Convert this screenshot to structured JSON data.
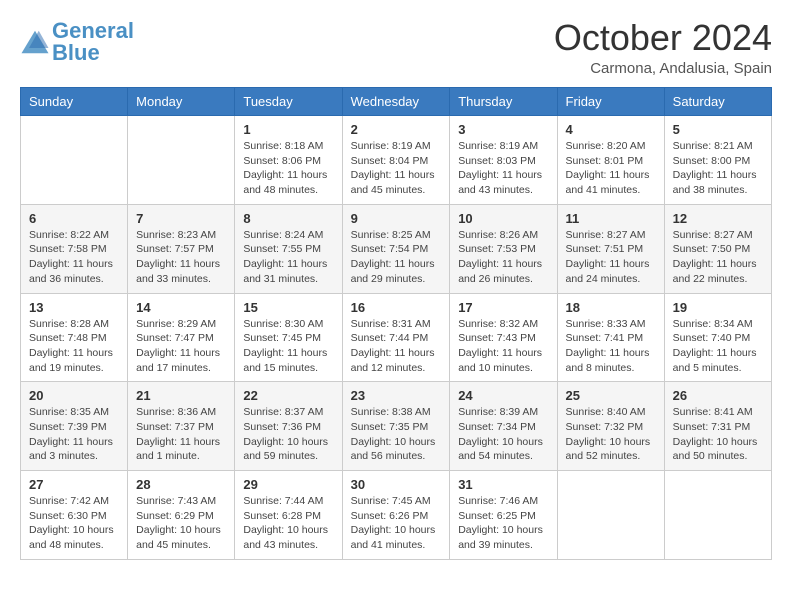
{
  "logo": {
    "line1": "General",
    "line2": "Blue"
  },
  "title": "October 2024",
  "subtitle": "Carmona, Andalusia, Spain",
  "days_of_week": [
    "Sunday",
    "Monday",
    "Tuesday",
    "Wednesday",
    "Thursday",
    "Friday",
    "Saturday"
  ],
  "weeks": [
    [
      {
        "day": "",
        "info": ""
      },
      {
        "day": "",
        "info": ""
      },
      {
        "day": "1",
        "info": "Sunrise: 8:18 AM\nSunset: 8:06 PM\nDaylight: 11 hours and 48 minutes."
      },
      {
        "day": "2",
        "info": "Sunrise: 8:19 AM\nSunset: 8:04 PM\nDaylight: 11 hours and 45 minutes."
      },
      {
        "day": "3",
        "info": "Sunrise: 8:19 AM\nSunset: 8:03 PM\nDaylight: 11 hours and 43 minutes."
      },
      {
        "day": "4",
        "info": "Sunrise: 8:20 AM\nSunset: 8:01 PM\nDaylight: 11 hours and 41 minutes."
      },
      {
        "day": "5",
        "info": "Sunrise: 8:21 AM\nSunset: 8:00 PM\nDaylight: 11 hours and 38 minutes."
      }
    ],
    [
      {
        "day": "6",
        "info": "Sunrise: 8:22 AM\nSunset: 7:58 PM\nDaylight: 11 hours and 36 minutes."
      },
      {
        "day": "7",
        "info": "Sunrise: 8:23 AM\nSunset: 7:57 PM\nDaylight: 11 hours and 33 minutes."
      },
      {
        "day": "8",
        "info": "Sunrise: 8:24 AM\nSunset: 7:55 PM\nDaylight: 11 hours and 31 minutes."
      },
      {
        "day": "9",
        "info": "Sunrise: 8:25 AM\nSunset: 7:54 PM\nDaylight: 11 hours and 29 minutes."
      },
      {
        "day": "10",
        "info": "Sunrise: 8:26 AM\nSunset: 7:53 PM\nDaylight: 11 hours and 26 minutes."
      },
      {
        "day": "11",
        "info": "Sunrise: 8:27 AM\nSunset: 7:51 PM\nDaylight: 11 hours and 24 minutes."
      },
      {
        "day": "12",
        "info": "Sunrise: 8:27 AM\nSunset: 7:50 PM\nDaylight: 11 hours and 22 minutes."
      }
    ],
    [
      {
        "day": "13",
        "info": "Sunrise: 8:28 AM\nSunset: 7:48 PM\nDaylight: 11 hours and 19 minutes."
      },
      {
        "day": "14",
        "info": "Sunrise: 8:29 AM\nSunset: 7:47 PM\nDaylight: 11 hours and 17 minutes."
      },
      {
        "day": "15",
        "info": "Sunrise: 8:30 AM\nSunset: 7:45 PM\nDaylight: 11 hours and 15 minutes."
      },
      {
        "day": "16",
        "info": "Sunrise: 8:31 AM\nSunset: 7:44 PM\nDaylight: 11 hours and 12 minutes."
      },
      {
        "day": "17",
        "info": "Sunrise: 8:32 AM\nSunset: 7:43 PM\nDaylight: 11 hours and 10 minutes."
      },
      {
        "day": "18",
        "info": "Sunrise: 8:33 AM\nSunset: 7:41 PM\nDaylight: 11 hours and 8 minutes."
      },
      {
        "day": "19",
        "info": "Sunrise: 8:34 AM\nSunset: 7:40 PM\nDaylight: 11 hours and 5 minutes."
      }
    ],
    [
      {
        "day": "20",
        "info": "Sunrise: 8:35 AM\nSunset: 7:39 PM\nDaylight: 11 hours and 3 minutes."
      },
      {
        "day": "21",
        "info": "Sunrise: 8:36 AM\nSunset: 7:37 PM\nDaylight: 11 hours and 1 minute."
      },
      {
        "day": "22",
        "info": "Sunrise: 8:37 AM\nSunset: 7:36 PM\nDaylight: 10 hours and 59 minutes."
      },
      {
        "day": "23",
        "info": "Sunrise: 8:38 AM\nSunset: 7:35 PM\nDaylight: 10 hours and 56 minutes."
      },
      {
        "day": "24",
        "info": "Sunrise: 8:39 AM\nSunset: 7:34 PM\nDaylight: 10 hours and 54 minutes."
      },
      {
        "day": "25",
        "info": "Sunrise: 8:40 AM\nSunset: 7:32 PM\nDaylight: 10 hours and 52 minutes."
      },
      {
        "day": "26",
        "info": "Sunrise: 8:41 AM\nSunset: 7:31 PM\nDaylight: 10 hours and 50 minutes."
      }
    ],
    [
      {
        "day": "27",
        "info": "Sunrise: 7:42 AM\nSunset: 6:30 PM\nDaylight: 10 hours and 48 minutes."
      },
      {
        "day": "28",
        "info": "Sunrise: 7:43 AM\nSunset: 6:29 PM\nDaylight: 10 hours and 45 minutes."
      },
      {
        "day": "29",
        "info": "Sunrise: 7:44 AM\nSunset: 6:28 PM\nDaylight: 10 hours and 43 minutes."
      },
      {
        "day": "30",
        "info": "Sunrise: 7:45 AM\nSunset: 6:26 PM\nDaylight: 10 hours and 41 minutes."
      },
      {
        "day": "31",
        "info": "Sunrise: 7:46 AM\nSunset: 6:25 PM\nDaylight: 10 hours and 39 minutes."
      },
      {
        "day": "",
        "info": ""
      },
      {
        "day": "",
        "info": ""
      }
    ]
  ]
}
